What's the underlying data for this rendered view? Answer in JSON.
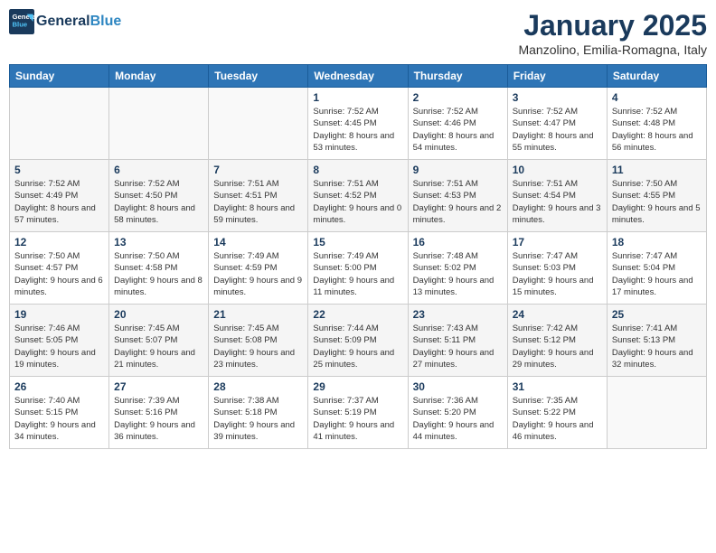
{
  "header": {
    "logo_line1": "General",
    "logo_line2": "Blue",
    "month_title": "January 2025",
    "location": "Manzolino, Emilia-Romagna, Italy"
  },
  "weekdays": [
    "Sunday",
    "Monday",
    "Tuesday",
    "Wednesday",
    "Thursday",
    "Friday",
    "Saturday"
  ],
  "weeks": [
    [
      {
        "day": "",
        "info": ""
      },
      {
        "day": "",
        "info": ""
      },
      {
        "day": "",
        "info": ""
      },
      {
        "day": "1",
        "info": "Sunrise: 7:52 AM\nSunset: 4:45 PM\nDaylight: 8 hours and 53 minutes."
      },
      {
        "day": "2",
        "info": "Sunrise: 7:52 AM\nSunset: 4:46 PM\nDaylight: 8 hours and 54 minutes."
      },
      {
        "day": "3",
        "info": "Sunrise: 7:52 AM\nSunset: 4:47 PM\nDaylight: 8 hours and 55 minutes."
      },
      {
        "day": "4",
        "info": "Sunrise: 7:52 AM\nSunset: 4:48 PM\nDaylight: 8 hours and 56 minutes."
      }
    ],
    [
      {
        "day": "5",
        "info": "Sunrise: 7:52 AM\nSunset: 4:49 PM\nDaylight: 8 hours and 57 minutes."
      },
      {
        "day": "6",
        "info": "Sunrise: 7:52 AM\nSunset: 4:50 PM\nDaylight: 8 hours and 58 minutes."
      },
      {
        "day": "7",
        "info": "Sunrise: 7:51 AM\nSunset: 4:51 PM\nDaylight: 8 hours and 59 minutes."
      },
      {
        "day": "8",
        "info": "Sunrise: 7:51 AM\nSunset: 4:52 PM\nDaylight: 9 hours and 0 minutes."
      },
      {
        "day": "9",
        "info": "Sunrise: 7:51 AM\nSunset: 4:53 PM\nDaylight: 9 hours and 2 minutes."
      },
      {
        "day": "10",
        "info": "Sunrise: 7:51 AM\nSunset: 4:54 PM\nDaylight: 9 hours and 3 minutes."
      },
      {
        "day": "11",
        "info": "Sunrise: 7:50 AM\nSunset: 4:55 PM\nDaylight: 9 hours and 5 minutes."
      }
    ],
    [
      {
        "day": "12",
        "info": "Sunrise: 7:50 AM\nSunset: 4:57 PM\nDaylight: 9 hours and 6 minutes."
      },
      {
        "day": "13",
        "info": "Sunrise: 7:50 AM\nSunset: 4:58 PM\nDaylight: 9 hours and 8 minutes."
      },
      {
        "day": "14",
        "info": "Sunrise: 7:49 AM\nSunset: 4:59 PM\nDaylight: 9 hours and 9 minutes."
      },
      {
        "day": "15",
        "info": "Sunrise: 7:49 AM\nSunset: 5:00 PM\nDaylight: 9 hours and 11 minutes."
      },
      {
        "day": "16",
        "info": "Sunrise: 7:48 AM\nSunset: 5:02 PM\nDaylight: 9 hours and 13 minutes."
      },
      {
        "day": "17",
        "info": "Sunrise: 7:47 AM\nSunset: 5:03 PM\nDaylight: 9 hours and 15 minutes."
      },
      {
        "day": "18",
        "info": "Sunrise: 7:47 AM\nSunset: 5:04 PM\nDaylight: 9 hours and 17 minutes."
      }
    ],
    [
      {
        "day": "19",
        "info": "Sunrise: 7:46 AM\nSunset: 5:05 PM\nDaylight: 9 hours and 19 minutes."
      },
      {
        "day": "20",
        "info": "Sunrise: 7:45 AM\nSunset: 5:07 PM\nDaylight: 9 hours and 21 minutes."
      },
      {
        "day": "21",
        "info": "Sunrise: 7:45 AM\nSunset: 5:08 PM\nDaylight: 9 hours and 23 minutes."
      },
      {
        "day": "22",
        "info": "Sunrise: 7:44 AM\nSunset: 5:09 PM\nDaylight: 9 hours and 25 minutes."
      },
      {
        "day": "23",
        "info": "Sunrise: 7:43 AM\nSunset: 5:11 PM\nDaylight: 9 hours and 27 minutes."
      },
      {
        "day": "24",
        "info": "Sunrise: 7:42 AM\nSunset: 5:12 PM\nDaylight: 9 hours and 29 minutes."
      },
      {
        "day": "25",
        "info": "Sunrise: 7:41 AM\nSunset: 5:13 PM\nDaylight: 9 hours and 32 minutes."
      }
    ],
    [
      {
        "day": "26",
        "info": "Sunrise: 7:40 AM\nSunset: 5:15 PM\nDaylight: 9 hours and 34 minutes."
      },
      {
        "day": "27",
        "info": "Sunrise: 7:39 AM\nSunset: 5:16 PM\nDaylight: 9 hours and 36 minutes."
      },
      {
        "day": "28",
        "info": "Sunrise: 7:38 AM\nSunset: 5:18 PM\nDaylight: 9 hours and 39 minutes."
      },
      {
        "day": "29",
        "info": "Sunrise: 7:37 AM\nSunset: 5:19 PM\nDaylight: 9 hours and 41 minutes."
      },
      {
        "day": "30",
        "info": "Sunrise: 7:36 AM\nSunset: 5:20 PM\nDaylight: 9 hours and 44 minutes."
      },
      {
        "day": "31",
        "info": "Sunrise: 7:35 AM\nSunset: 5:22 PM\nDaylight: 9 hours and 46 minutes."
      },
      {
        "day": "",
        "info": ""
      }
    ]
  ]
}
